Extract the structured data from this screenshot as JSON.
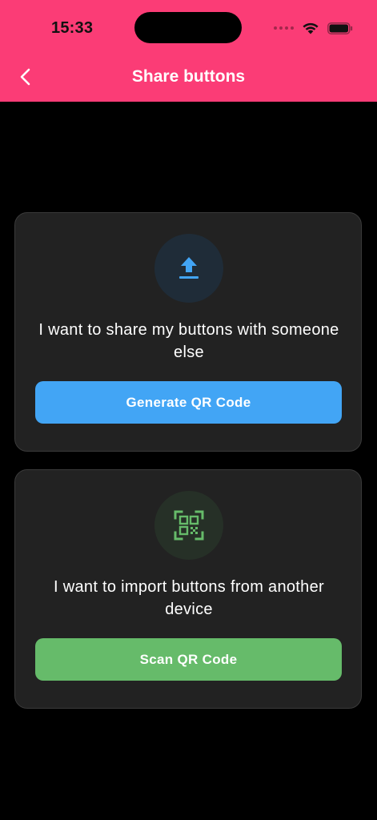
{
  "status_bar": {
    "time": "15:33"
  },
  "nav": {
    "title": "Share buttons",
    "back_icon": "chevron-left-icon"
  },
  "share_card": {
    "icon": "upload-icon",
    "text": "I want to share my buttons with someone else",
    "button_label": "Generate QR Code",
    "accent_color": "#42a5f5"
  },
  "import_card": {
    "icon": "qr-scan-icon",
    "text": "I want to import buttons from another device",
    "button_label": "Scan QR Code",
    "accent_color": "#66bb6a"
  },
  "colors": {
    "header": "#fb3c76",
    "background": "#000000",
    "card": "#222222"
  }
}
